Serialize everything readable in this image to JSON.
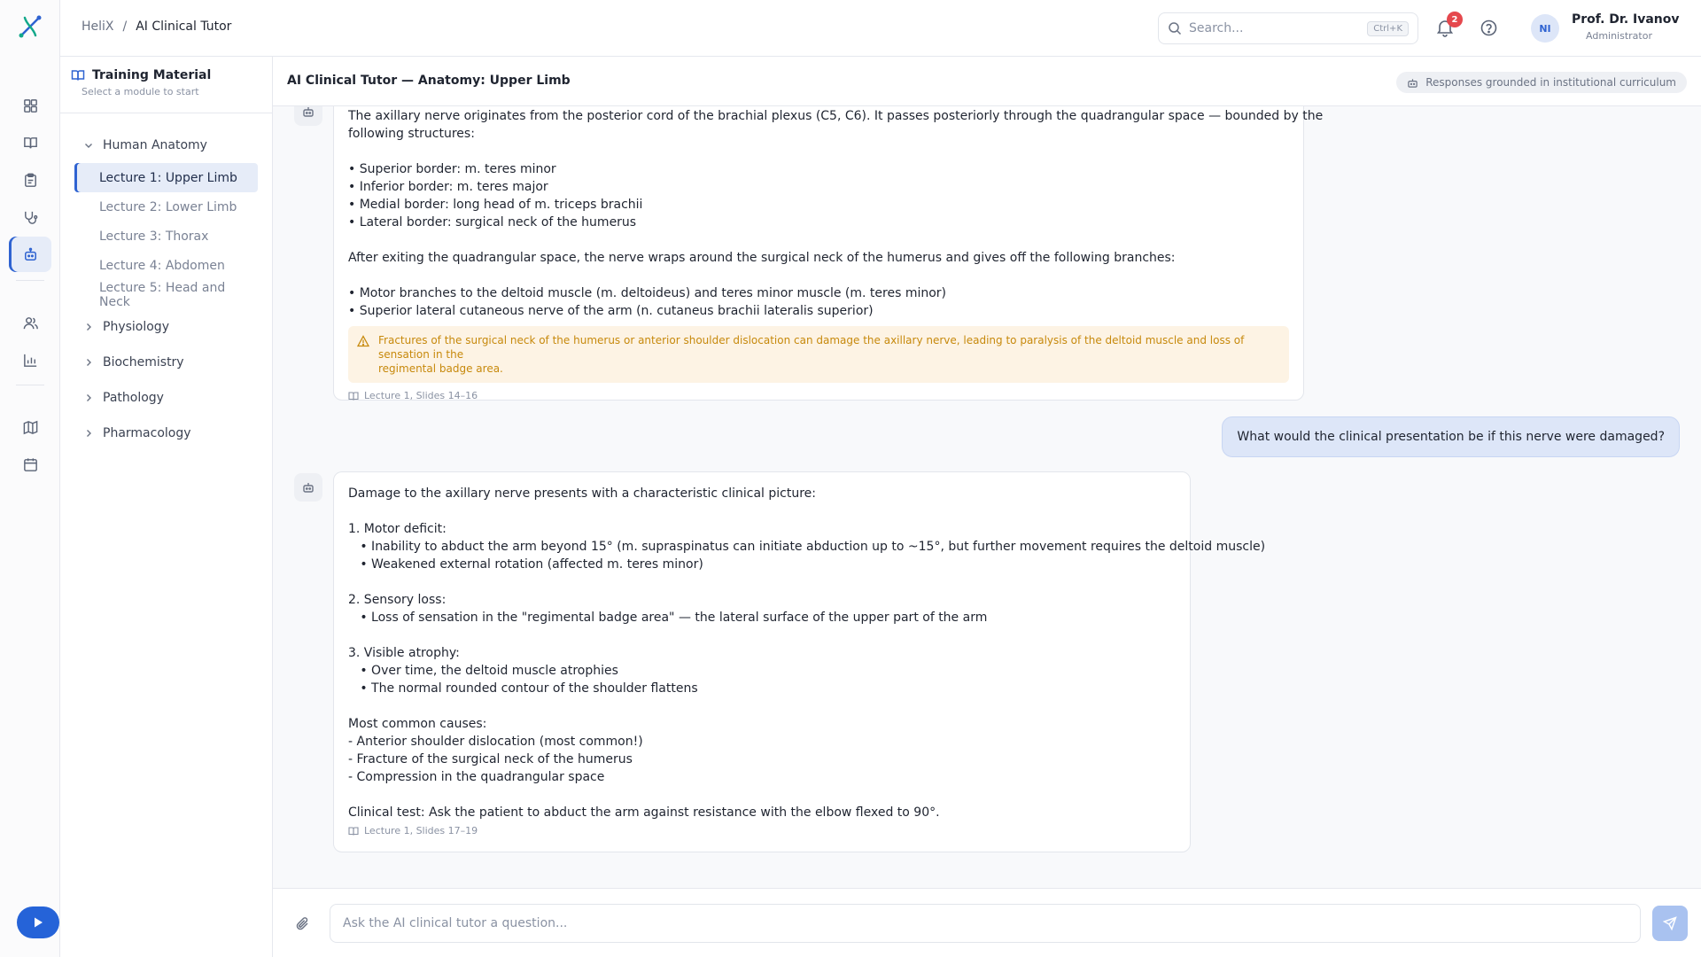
{
  "breadcrumb": {
    "root": "HeliX",
    "separator": "/",
    "current": "AI Clinical Tutor"
  },
  "search": {
    "placeholder": "Search...",
    "shortcut": "Ctrl+K"
  },
  "notifications": {
    "count": "2"
  },
  "user": {
    "initials": "NI",
    "name": "Prof. Dr. Ivanov",
    "role": "Administrator"
  },
  "rail": {
    "icons": [
      "dashboard-icon",
      "book-icon",
      "clipboard-icon",
      "stethoscope-icon",
      "bot-icon",
      "users-icon",
      "bar-chart-icon",
      "map-icon",
      "calendar-icon"
    ],
    "active": "bot-icon"
  },
  "module_panel": {
    "title": "Training Material",
    "subtitle": "Select a module to start",
    "categories": [
      {
        "label": "Human Anatomy",
        "expanded": true,
        "items": [
          "Lecture 1: Upper Limb",
          "Lecture 2: Lower Limb",
          "Lecture 3: Thorax",
          "Lecture 4: Abdomen",
          "Lecture 5: Head and Neck"
        ]
      },
      {
        "label": "Physiology",
        "expanded": false
      },
      {
        "label": "Biochemistry",
        "expanded": false
      },
      {
        "label": "Pathology",
        "expanded": false
      },
      {
        "label": "Pharmacology",
        "expanded": false
      }
    ],
    "active_item": "Lecture 1: Upper Limb"
  },
  "chat": {
    "title": "AI Clinical Tutor — Anatomy: Upper Limb",
    "grounded_label": "Responses grounded in institutional curriculum",
    "message1": {
      "lines": [
        "The axillary nerve originates from the posterior cord of the brachial plexus (C5, C6). It passes posteriorly through the quadrangular space — bounded by the",
        "following structures:",
        "",
        "• Superior border: m. teres minor",
        "• Inferior border: m. teres major",
        "• Medial border: long head of m. triceps brachii",
        "• Lateral border: surgical neck of the humerus",
        "",
        "After exiting the quadrangular space, the nerve wraps around the surgical neck of the humerus and gives off the following branches:",
        "",
        "• Motor branches to the deltoid muscle (m. deltoideus) and teres minor muscle (m. teres minor)",
        "• Superior lateral cutaneous nerve of the arm (n. cutaneus brachii lateralis superior)"
      ],
      "warning_line1": "Fractures of the surgical neck of the humerus or anterior shoulder dislocation can damage the axillary nerve, leading to paralysis of the deltoid muscle and loss of sensation in the",
      "warning_line2": "regimental badge area.",
      "source": "Lecture 1, Slides 14–16"
    },
    "user_message": "What would the clinical presentation be if this nerve were damaged?",
    "message2": {
      "lines": [
        "Damage to the axillary nerve presents with a characteristic clinical picture:",
        "",
        "1. Motor deficit:",
        "   • Inability to abduct the arm beyond 15° (m. supraspinatus can initiate abduction up to ~15°, but further movement requires the deltoid muscle)",
        "   • Weakened external rotation (affected m. teres minor)",
        "",
        "2. Sensory loss:",
        "   • Loss of sensation in the \"regimental badge area\" — the lateral surface of the upper part of the arm",
        "",
        "3. Visible atrophy:",
        "   • Over time, the deltoid muscle atrophies",
        "   • The normal rounded contour of the shoulder flattens",
        "",
        "Most common causes:",
        "- Anterior shoulder dislocation (most common!)",
        "- Fracture of the surgical neck of the humerus",
        "- Compression in the quadrangular space",
        "",
        "Clinical test: Ask the patient to abduct the arm against resistance with the elbow flexed to 90°."
      ],
      "source": "Lecture 1, Slides 17–19"
    },
    "composer_placeholder": "Ask the AI clinical tutor a question..."
  },
  "colors": {
    "accent": "#2563d8",
    "active_bg": "#e6ecf8",
    "warning_bg": "#fdf3e4",
    "warning_text": "#c7890c",
    "badge": "#e5484d"
  }
}
